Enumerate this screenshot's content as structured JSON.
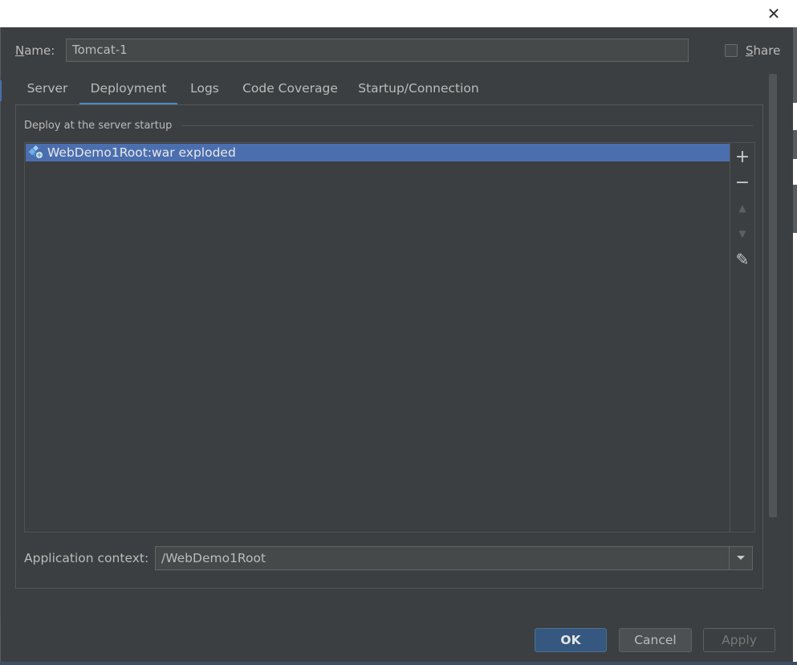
{
  "dialog": {
    "close_glyph": "✕"
  },
  "name": {
    "label_mnemonic": "N",
    "label_rest": "ame:",
    "value": "Tomcat-1"
  },
  "share": {
    "label_mnemonic": "S",
    "label_rest": "hare",
    "checked": false
  },
  "tabs": [
    {
      "label": "Server",
      "active": false
    },
    {
      "label": "Deployment",
      "active": true
    },
    {
      "label": "Logs",
      "active": false
    },
    {
      "label": "Code Coverage",
      "active": false
    },
    {
      "label": "Startup/Connection",
      "active": false
    }
  ],
  "deploy": {
    "section_title": "Deploy at the server startup",
    "items": [
      {
        "label": "WebDemo1Root:war exploded",
        "icon": "artifact-icon",
        "selected": true
      }
    ],
    "toolbar": {
      "add": {
        "glyph": "+",
        "icon": "plus-icon",
        "enabled": true
      },
      "remove": {
        "glyph": "−",
        "icon": "minus-icon",
        "enabled": true
      },
      "move_up": {
        "glyph": "▲",
        "icon": "arrow-up-icon",
        "enabled": false
      },
      "move_down": {
        "glyph": "▼",
        "icon": "arrow-down-icon",
        "enabled": false
      },
      "edit": {
        "glyph": "✎",
        "icon": "pencil-icon",
        "enabled": true
      }
    }
  },
  "app_context": {
    "label": "Application context:",
    "value": "/WebDemo1Root"
  },
  "buttons": {
    "ok": "OK",
    "cancel": "Cancel",
    "apply": "Apply",
    "apply_enabled": false
  },
  "colors": {
    "background": "#3c3f41",
    "selection": "#4b6eaf",
    "tab_underline": "#4a88c7",
    "ok_button": "#365880"
  }
}
